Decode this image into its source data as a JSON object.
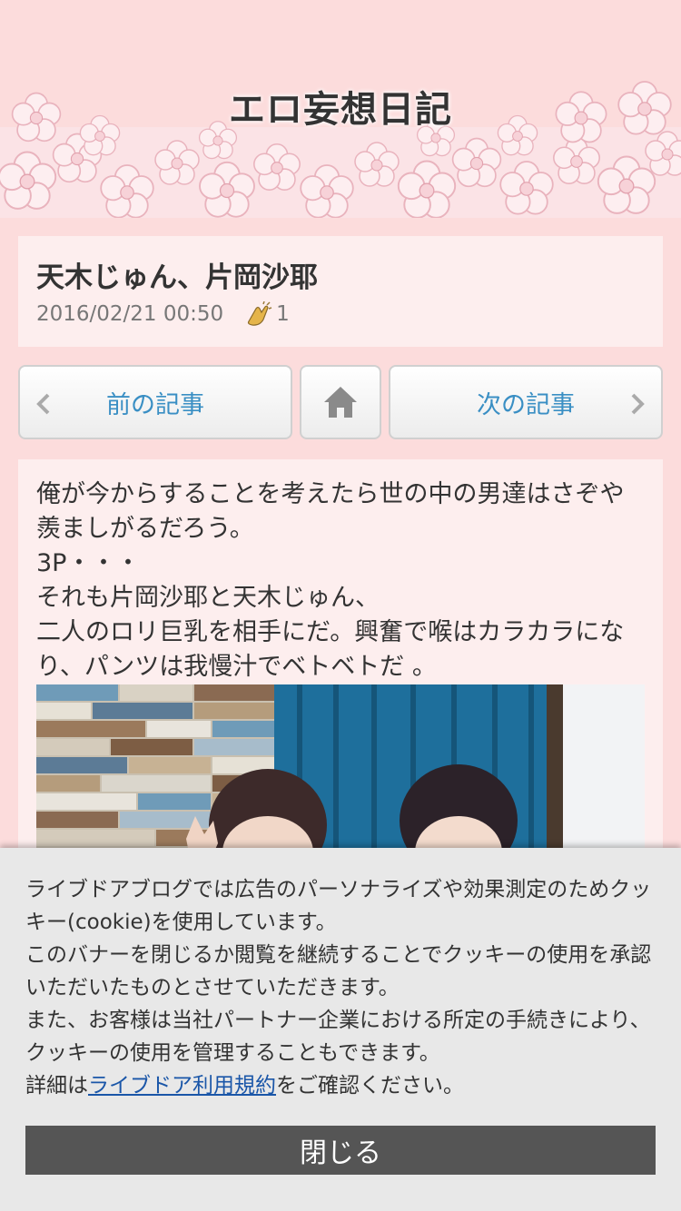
{
  "header": {
    "site_title": "エロ妄想日記"
  },
  "article": {
    "title": "天木じゅん、片岡沙耶",
    "date": "2016/02/21 00:50",
    "clap_count": "1",
    "body_lines": [
      "俺が今からすることを考えたら世の中の男達はさぞや羨ましがるだろう。",
      "3P・・・",
      "それも片岡沙耶と天木じゅん、",
      "二人のロリ巨乳を相手にだ。興奮で喉はカラカラになり、パンツは我慢汁でベトベトだ 。"
    ]
  },
  "nav": {
    "prev_label": "前の記事",
    "next_label": "次の記事",
    "home_icon": "home-icon",
    "link_color": "#3a8fc4"
  },
  "cookie": {
    "line1": "ライブドアブログでは広告のパーソナライズや効果測定のためクッキー(cookie)を使用しています。",
    "line2": "このバナーを閉じるか閲覧を継続することでクッキーの使用を承認いただいたものとさせていただきます。",
    "line3": "また、お客様は当社パートナー企業における所定の手続きにより、クッキーの使用を管理することもできます。",
    "line4_prefix": "詳細は",
    "terms_link": "ライブドア利用規約",
    "line4_suffix": "をご確認ください。",
    "close_label": "閉じる"
  },
  "colors": {
    "page_background": "#fcdcdc",
    "card_background": "#fdeeee"
  }
}
